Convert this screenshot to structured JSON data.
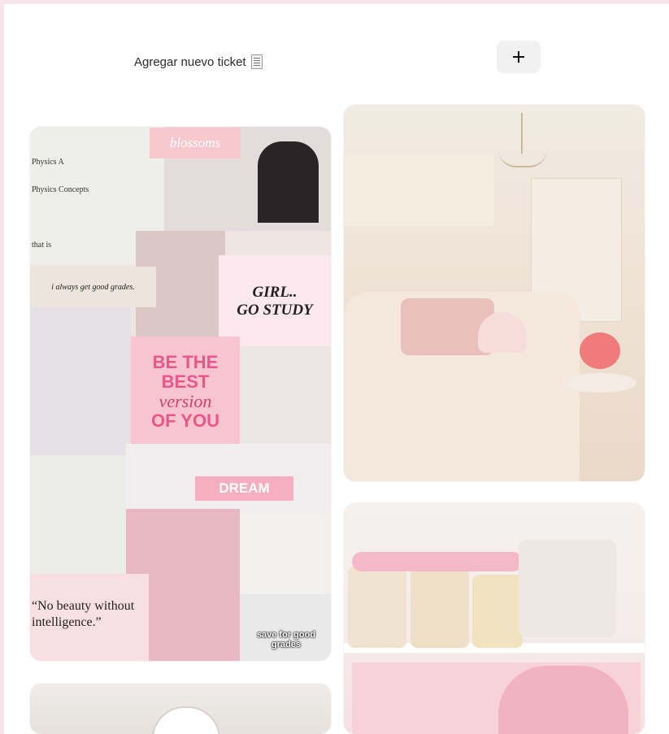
{
  "header": {
    "add_ticket_label": "Agregar nuevo ticket",
    "ticket_icon": "receipt-icon",
    "add_button_icon": "plus-icon"
  },
  "gallery": {
    "cards": [
      {
        "id": "study-moodboard",
        "texts": {
          "blossoms": "blossoms",
          "physics_1": "Physics A",
          "physics_2": "Physics Concepts",
          "that_is": "that is",
          "grades": "i always get good grades.",
          "girl": "GIRL..",
          "go_study": "GO STUDY",
          "be_the": "BE THE",
          "best": "BEST",
          "version": "version",
          "of_you": "OF YOU",
          "dream": "DREAM",
          "quote": "“No beauty without intelligence.”",
          "save": "save for good grades"
        }
      },
      {
        "id": "living-room"
      },
      {
        "id": "pink-kitchen-shelf"
      },
      {
        "id": "bottom-left-image"
      }
    ]
  },
  "colors": {
    "page_background": "#f6e6ec",
    "panel_background": "#ffffff",
    "button_background": "#f1f1f1",
    "accent_pink": "#f8c4d2"
  }
}
